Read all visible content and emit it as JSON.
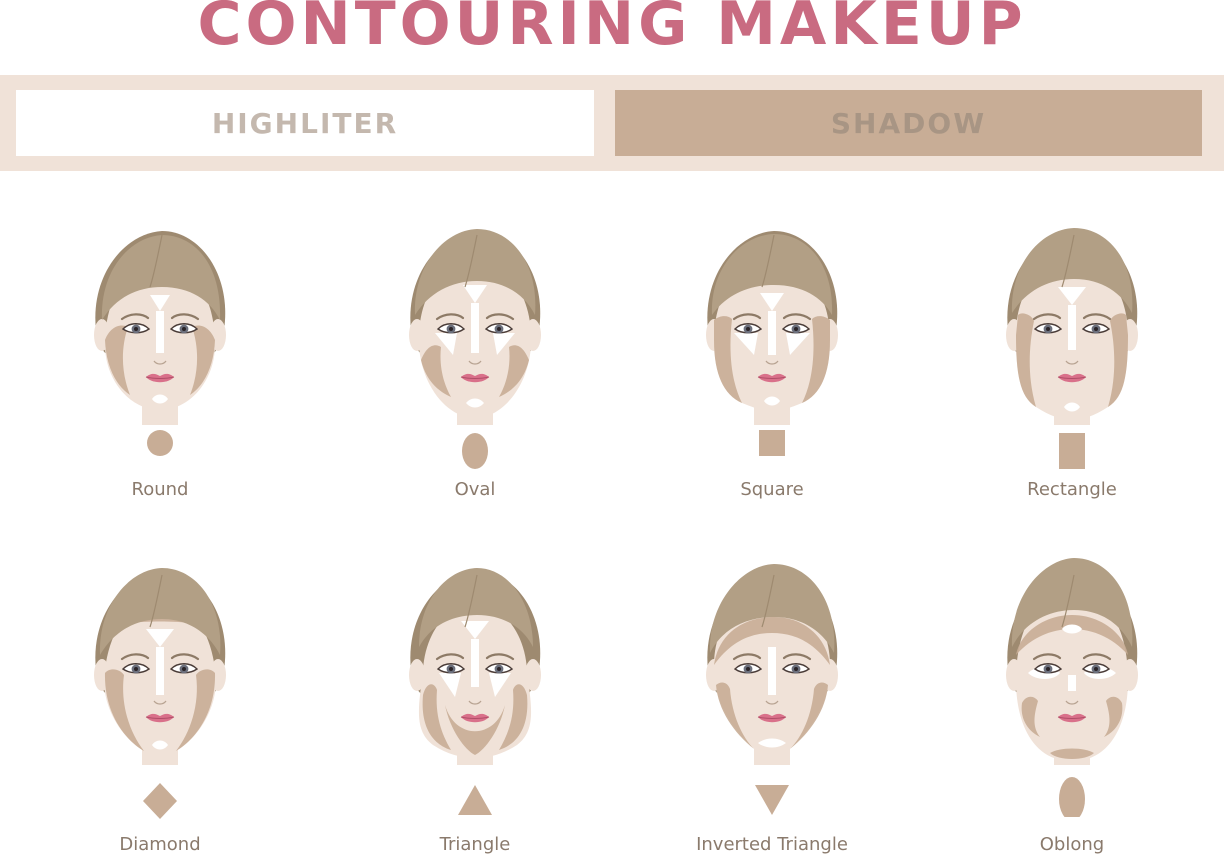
{
  "title": "CONTOURING MAKEUP",
  "legend": {
    "highlighter": "HIGHLITER",
    "shadow": "SHADOW"
  },
  "colors": {
    "title": "#c96b81",
    "legend_text_high": "#c4b8ae",
    "legend_text_shadow": "#a89584",
    "shadow": "#c8ad96",
    "highlight": "#ffffff",
    "skin": "#f0e2d8",
    "hair": "#b29f85",
    "hair_dark": "#9e8a70",
    "lips": "#d9708a",
    "label": "#8a7a6c"
  },
  "faces": [
    {
      "label": "Round",
      "shape": "circle"
    },
    {
      "label": "Oval",
      "shape": "oval"
    },
    {
      "label": "Square",
      "shape": "square"
    },
    {
      "label": "Rectangle",
      "shape": "rectangle"
    },
    {
      "label": "Diamond",
      "shape": "diamond"
    },
    {
      "label": "Triangle",
      "shape": "triangle"
    },
    {
      "label": "Inverted Triangle",
      "shape": "inverted-triangle"
    },
    {
      "label": "Oblong",
      "shape": "oblong"
    }
  ]
}
